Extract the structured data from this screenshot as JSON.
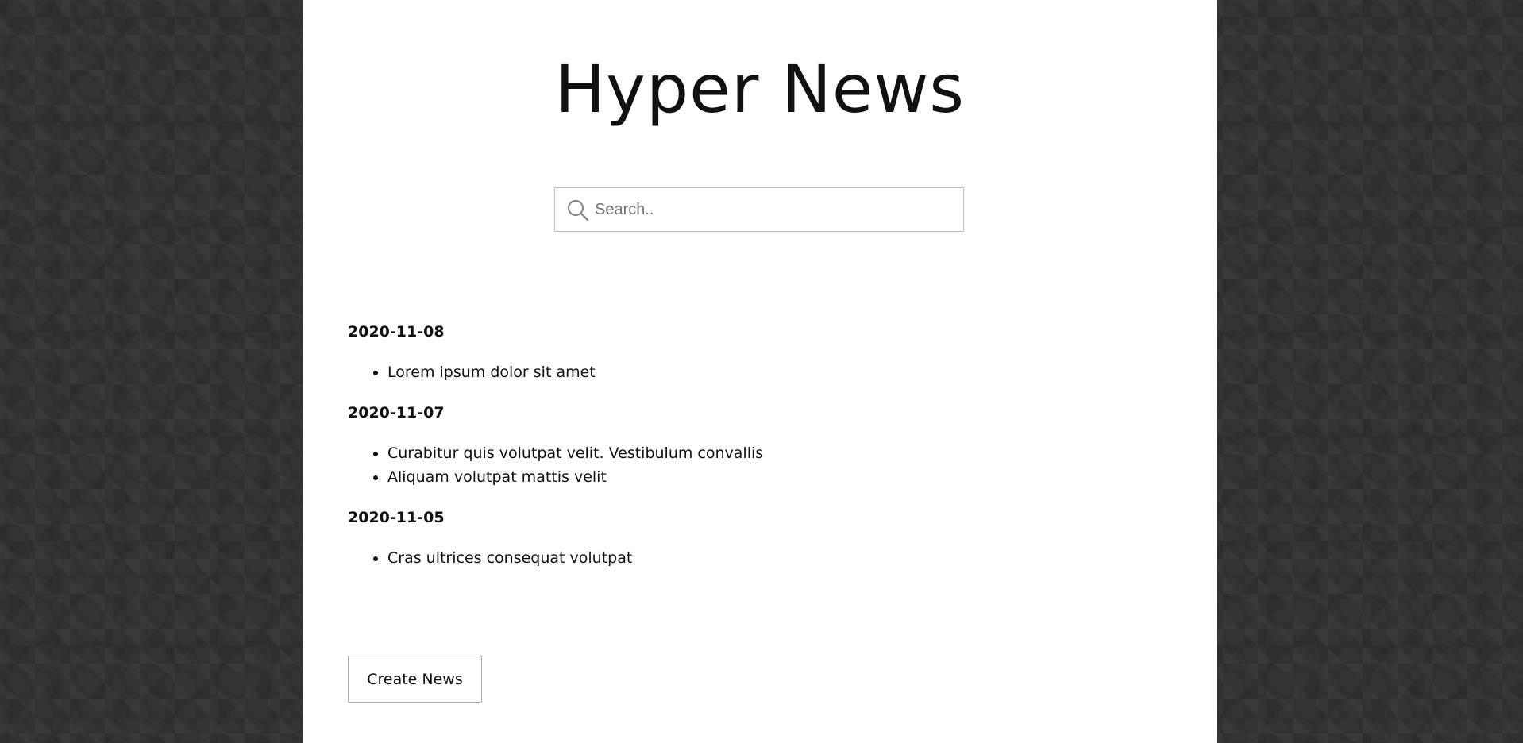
{
  "header": {
    "title": "Hyper News"
  },
  "search": {
    "placeholder": "Search..",
    "value": "",
    "icon": "search-icon"
  },
  "news": [
    {
      "date": "2020-11-08",
      "items": [
        "Lorem ipsum dolor sit amet"
      ]
    },
    {
      "date": "2020-11-07",
      "items": [
        "Curabitur quis volutpat velit. Vestibulum convallis",
        "Aliquam volutpat mattis velit"
      ]
    },
    {
      "date": "2020-11-05",
      "items": [
        "Cras ultrices consequat volutpat"
      ]
    }
  ],
  "actions": {
    "create_label": "Create News"
  },
  "colors": {
    "background": "#333333",
    "panel": "#ffffff",
    "text": "#111111"
  }
}
